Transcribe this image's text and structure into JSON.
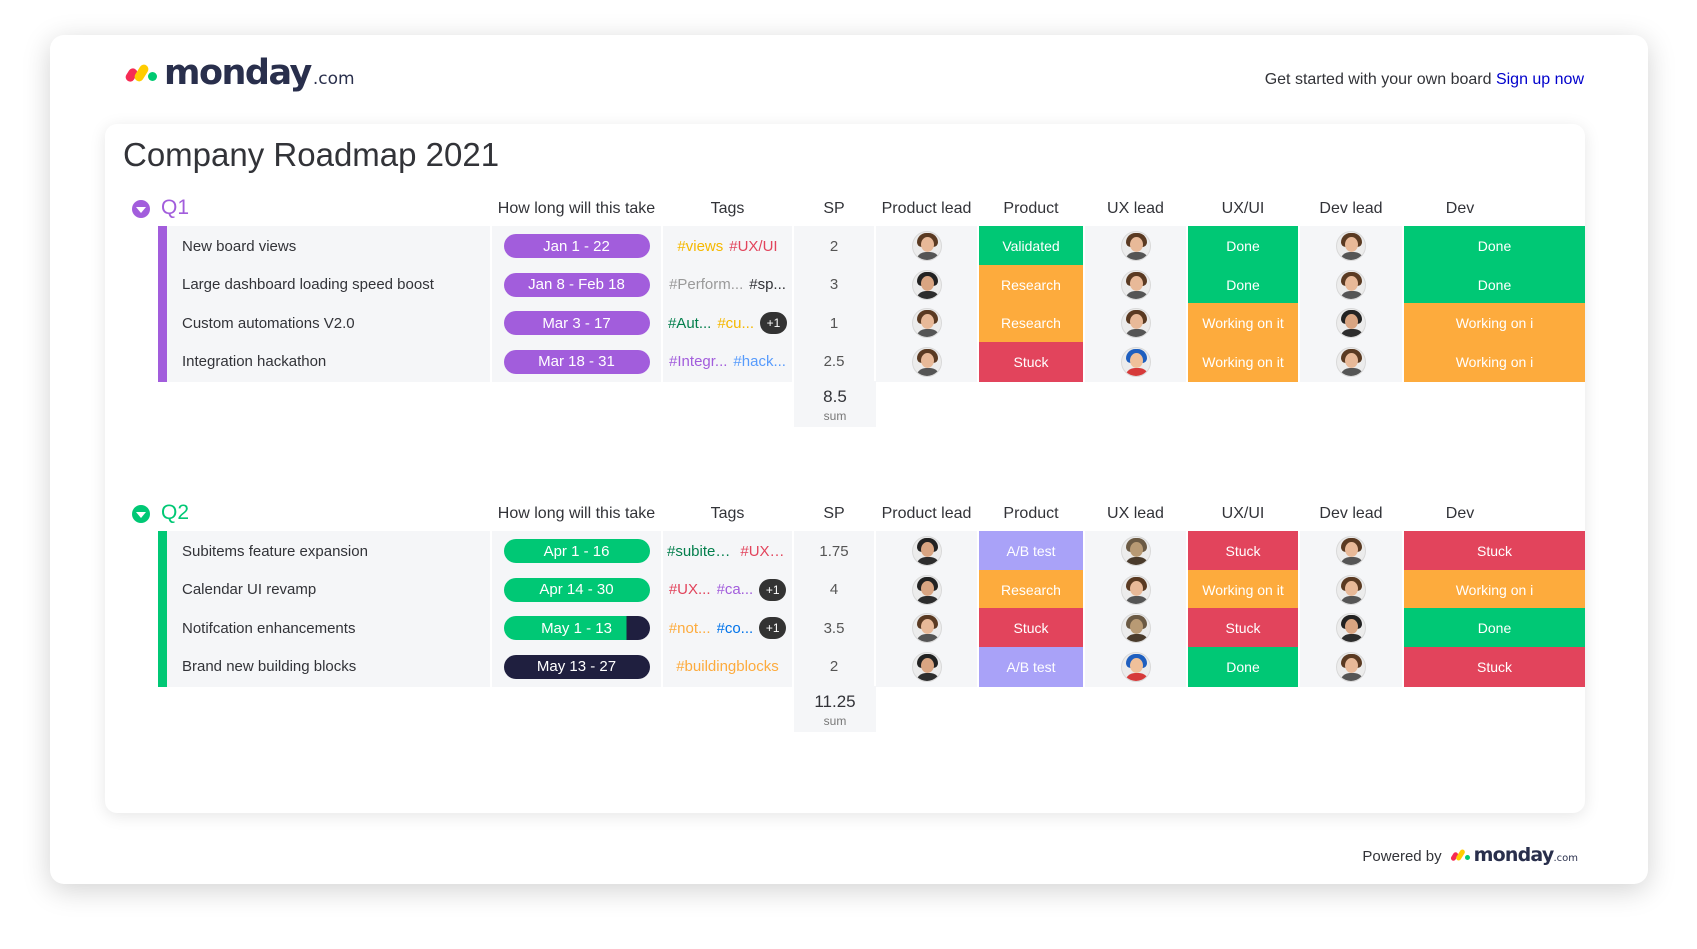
{
  "brand": {
    "word": "monday",
    "suffix": ".com"
  },
  "signup": {
    "text": "Get started with your own board",
    "link": "Sign up now"
  },
  "board": {
    "title": "Company Roadmap 2021"
  },
  "columns": [
    "How long will this take",
    "Tags",
    "SP",
    "Product lead",
    "Product",
    "UX lead",
    "UX/UI",
    "Dev lead",
    "Dev"
  ],
  "colors": {
    "q1": "#a25ddc",
    "q2": "#00c875",
    "dark": "#1f1f3f",
    "green": "#00c875",
    "orange": "#fdab3d",
    "red": "#e2445c",
    "purple": "#a9a2f8"
  },
  "groups": [
    {
      "name": "Q1",
      "color": "#a25ddc",
      "sum": {
        "value": "8.5",
        "label": "sum"
      },
      "rows": [
        {
          "name": "New board views",
          "timeline": "Jan 1 - 22",
          "timeline_progress": 1.0,
          "tags": [
            {
              "t": "#views",
              "c": "#f5b800"
            },
            {
              "t": "#UX/UI",
              "c": "#e2445c"
            }
          ],
          "plus": "",
          "sp": "2",
          "product_lead": "avatar-woman-icon",
          "product": {
            "label": "Validated",
            "color": "#00c875"
          },
          "ux_lead": "avatar-woman-icon",
          "uxui": {
            "label": "Done",
            "color": "#00c875"
          },
          "dev_lead": "avatar-woman-icon",
          "dev": {
            "label": "Done",
            "color": "#00c875"
          }
        },
        {
          "name": "Large dashboard loading speed boost",
          "timeline": "Jan 8 - Feb 18",
          "timeline_progress": 1.0,
          "tags": [
            {
              "t": "#Perform...",
              "c": "#9a9a9a"
            },
            {
              "t": "#sp...",
              "c": "#323338"
            }
          ],
          "plus": "",
          "sp": "3",
          "product_lead": "avatar-man-icon",
          "product": {
            "label": "Research",
            "color": "#fdab3d"
          },
          "ux_lead": "avatar-woman-icon",
          "uxui": {
            "label": "Done",
            "color": "#00c875"
          },
          "dev_lead": "avatar-woman-icon",
          "dev": {
            "label": "Done",
            "color": "#00c875"
          }
        },
        {
          "name": "Custom automations V2.0",
          "timeline": "Mar 3 - 17",
          "timeline_progress": 1.0,
          "tags": [
            {
              "t": "#Aut...",
              "c": "#037f4c"
            },
            {
              "t": "#cu...",
              "c": "#f5b800"
            }
          ],
          "plus": "+1",
          "sp": "1",
          "product_lead": "avatar-woman-icon",
          "product": {
            "label": "Research",
            "color": "#fdab3d"
          },
          "ux_lead": "avatar-woman-icon",
          "uxui": {
            "label": "Working on it",
            "color": "#fdab3d"
          },
          "dev_lead": "avatar-man-icon",
          "dev": {
            "label": "Working on i",
            "color": "#fdab3d"
          }
        },
        {
          "name": "Integration hackathon",
          "timeline": "Mar 18 - 31",
          "timeline_progress": 1.0,
          "tags": [
            {
              "t": "#Integr...",
              "c": "#a25ddc"
            },
            {
              "t": "#hack...",
              "c": "#579bfc"
            }
          ],
          "plus": "",
          "sp": "2.5",
          "product_lead": "avatar-woman-icon",
          "product": {
            "label": "Stuck",
            "color": "#e2445c"
          },
          "ux_lead": "avatar-hero-icon",
          "uxui": {
            "label": "Working on it",
            "color": "#fdab3d"
          },
          "dev_lead": "avatar-woman-icon",
          "dev": {
            "label": "Working on i",
            "color": "#fdab3d"
          }
        }
      ]
    },
    {
      "name": "Q2",
      "color": "#00c875",
      "sum": {
        "value": "11.25",
        "label": "sum"
      },
      "rows": [
        {
          "name": "Subitems feature expansion",
          "timeline": "Apr 1 - 16",
          "timeline_progress": 1.0,
          "tags": [
            {
              "t": "#subitems",
              "c": "#037f4c"
            },
            {
              "t": "#UX/UI",
              "c": "#e2445c"
            }
          ],
          "plus": "",
          "sp": "1.75",
          "product_lead": "avatar-man-icon",
          "product": {
            "label": "A/B test",
            "color": "#a9a2f8"
          },
          "ux_lead": "avatar-dog-icon",
          "uxui": {
            "label": "Stuck",
            "color": "#e2445c"
          },
          "dev_lead": "avatar-woman-icon",
          "dev": {
            "label": "Stuck",
            "color": "#e2445c"
          }
        },
        {
          "name": "Calendar UI revamp",
          "timeline": "Apr 14 - 30",
          "timeline_progress": 1.0,
          "tags": [
            {
              "t": "#UX...",
              "c": "#e2445c"
            },
            {
              "t": "#ca...",
              "c": "#a25ddc"
            }
          ],
          "plus": "+1",
          "sp": "4",
          "product_lead": "avatar-man-icon",
          "product": {
            "label": "Research",
            "color": "#fdab3d"
          },
          "ux_lead": "avatar-woman-icon",
          "uxui": {
            "label": "Working on it",
            "color": "#fdab3d"
          },
          "dev_lead": "avatar-woman-icon",
          "dev": {
            "label": "Working on i",
            "color": "#fdab3d"
          }
        },
        {
          "name": "Notifcation enhancements",
          "timeline": "May 1 - 13",
          "timeline_progress": 0.84,
          "tags": [
            {
              "t": "#not...",
              "c": "#fdab3d"
            },
            {
              "t": "#co...",
              "c": "#0073ea"
            }
          ],
          "plus": "+1",
          "sp": "3.5",
          "product_lead": "avatar-woman-icon",
          "product": {
            "label": "Stuck",
            "color": "#e2445c"
          },
          "ux_lead": "avatar-dog-icon",
          "uxui": {
            "label": "Stuck",
            "color": "#e2445c"
          },
          "dev_lead": "avatar-man-icon",
          "dev": {
            "label": "Done",
            "color": "#00c875"
          }
        },
        {
          "name": "Brand new building blocks",
          "timeline": "May 13 - 27",
          "timeline_progress": 0.0,
          "tags": [
            {
              "t": "#buildingblocks",
              "c": "#fdab3d"
            }
          ],
          "plus": "",
          "sp": "2",
          "product_lead": "avatar-man-icon",
          "product": {
            "label": "A/B test",
            "color": "#a9a2f8"
          },
          "ux_lead": "avatar-hero-icon",
          "uxui": {
            "label": "Done",
            "color": "#00c875"
          },
          "dev_lead": "avatar-woman-icon",
          "dev": {
            "label": "Stuck",
            "color": "#e2445c"
          }
        }
      ]
    }
  ],
  "footer": {
    "powered_text": "Powered by",
    "word": "monday",
    "suffix": ".com"
  }
}
